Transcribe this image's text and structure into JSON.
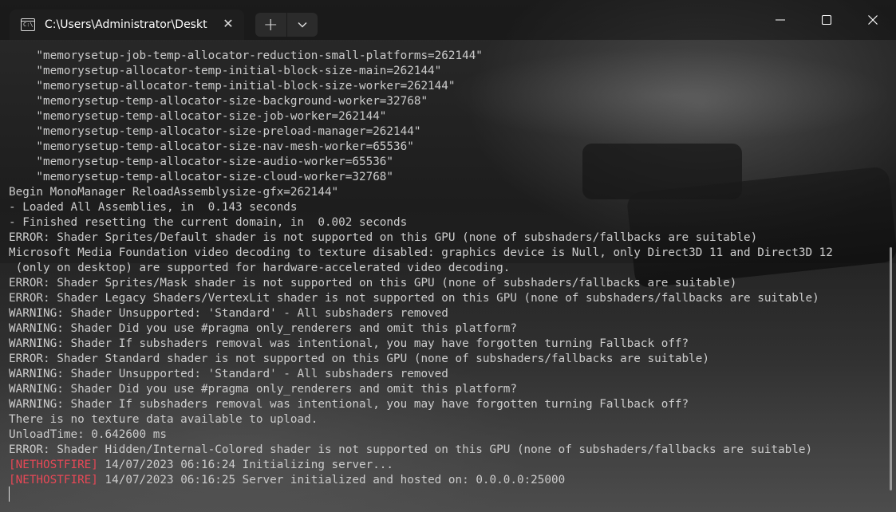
{
  "window": {
    "tab_title": "C:\\Users\\Administrator\\Deskt",
    "tab_icon": "terminal-icon"
  },
  "controls": {
    "new_tab": "+",
    "dropdown": "⌵",
    "minimize": "—",
    "maximize": "☐",
    "close": "✕",
    "tab_close": "✕"
  },
  "terminal": {
    "lines": [
      {
        "text": "    \"memorysetup-job-temp-allocator-reduction-small-platforms=262144\""
      },
      {
        "text": "    \"memorysetup-allocator-temp-initial-block-size-main=262144\""
      },
      {
        "text": "    \"memorysetup-allocator-temp-initial-block-size-worker=262144\""
      },
      {
        "text": "    \"memorysetup-temp-allocator-size-background-worker=32768\""
      },
      {
        "text": "    \"memorysetup-temp-allocator-size-job-worker=262144\""
      },
      {
        "text": "    \"memorysetup-temp-allocator-size-preload-manager=262144\""
      },
      {
        "text": "    \"memorysetup-temp-allocator-size-nav-mesh-worker=65536\""
      },
      {
        "text": "    \"memorysetup-temp-allocator-size-audio-worker=65536\""
      },
      {
        "text": "    \"memorysetup-temp-allocator-size-cloud-worker=32768\""
      },
      {
        "text": "Begin MonoManager ReloadAssemblysize-gfx=262144\""
      },
      {
        "text": "- Loaded All Assemblies, in  0.143 seconds"
      },
      {
        "text": "- Finished resetting the current domain, in  0.002 seconds"
      },
      {
        "text": "ERROR: Shader Sprites/Default shader is not supported on this GPU (none of subshaders/fallbacks are suitable)"
      },
      {
        "text": "Microsoft Media Foundation video decoding to texture disabled: graphics device is Null, only Direct3D 11 and Direct3D 12"
      },
      {
        "text": " (only on desktop) are supported for hardware-accelerated video decoding."
      },
      {
        "text": "ERROR: Shader Sprites/Mask shader is not supported on this GPU (none of subshaders/fallbacks are suitable)"
      },
      {
        "text": "ERROR: Shader Legacy Shaders/VertexLit shader is not supported on this GPU (none of subshaders/fallbacks are suitable)"
      },
      {
        "text": "WARNING: Shader Unsupported: 'Standard' - All subshaders removed"
      },
      {
        "text": "WARNING: Shader Did you use #pragma only_renderers and omit this platform?"
      },
      {
        "text": "WARNING: Shader If subshaders removal was intentional, you may have forgotten turning Fallback off?"
      },
      {
        "text": "ERROR: Shader Standard shader is not supported on this GPU (none of subshaders/fallbacks are suitable)"
      },
      {
        "text": "WARNING: Shader Unsupported: 'Standard' - All subshaders removed"
      },
      {
        "text": "WARNING: Shader Did you use #pragma only_renderers and omit this platform?"
      },
      {
        "text": "WARNING: Shader If subshaders removal was intentional, you may have forgotten turning Fallback off?"
      },
      {
        "text": "There is no texture data available to upload."
      },
      {
        "text": "UnloadTime: 0.642600 ms"
      },
      {
        "text": "ERROR: Shader Hidden/Internal-Colored shader is not supported on this GPU (none of subshaders/fallbacks are suitable)"
      },
      {
        "prefix": "[NETHOSTFIRE]",
        "text": " 14/07/2023 06:16:24 Initializing server..."
      },
      {
        "prefix": "[NETHOSTFIRE]",
        "text": " 14/07/2023 06:16:25 Server initialized and hosted on: 0.0.0.0:25000"
      }
    ]
  },
  "colors": {
    "prefix": "#e74856",
    "text": "#cccccc"
  }
}
